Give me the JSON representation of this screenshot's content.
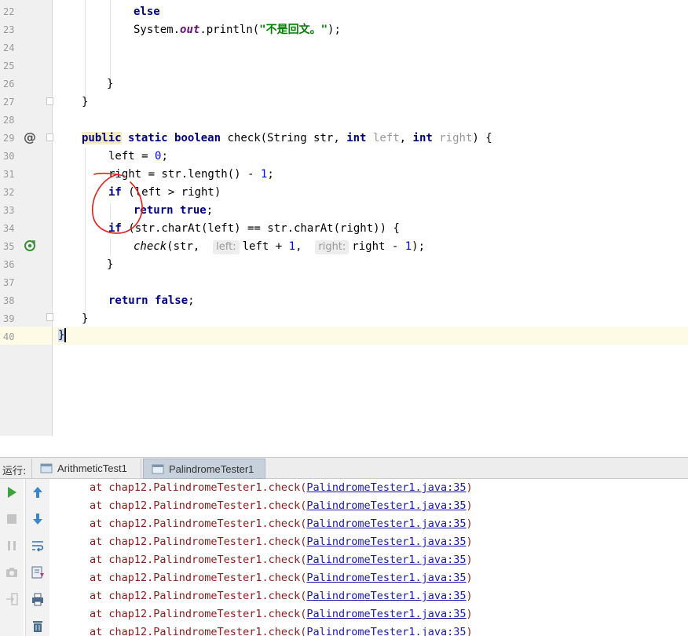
{
  "editor": {
    "line_numbers": [
      "22",
      "23",
      "24",
      "25",
      "26",
      "27",
      "28",
      "29",
      "30",
      "31",
      "32",
      "33",
      "34",
      "35",
      "36",
      "37",
      "38",
      "39",
      "40"
    ],
    "code": {
      "l22_else": "else",
      "l23_system": "System.",
      "l23_out": "out",
      "l23_println": ".println(",
      "l23_string": "\"不是回文。\"",
      "l23_end": ");",
      "l26": "}",
      "l27": "}",
      "l29_public": "public",
      "l29_static": "static",
      "l29_boolean": "boolean",
      "l29_sig1": " check(String str, ",
      "l29_int1": "int",
      "l29_left": "left",
      "l29_comma": ", ",
      "l29_int2": "int",
      "l29_right": "right",
      "l29_end": ") {",
      "l30_a": "left = ",
      "l30_num": "0",
      "l30_end": ";",
      "l31_a": "right = str.length() - ",
      "l31_num": "1",
      "l31_end": ";",
      "l32_if": "if",
      "l32_rest": " (left > right)",
      "l33_return": "return",
      "l33_true": "true",
      "l33_end": ";",
      "l34_if": "if",
      "l34_rest": " (str.charAt(left) == str.charAt(right)) {",
      "l35_check": "check",
      "l35_a": "(str,  ",
      "l35_hint_left": "left:",
      "l35_b": "left + ",
      "l35_num1": "1",
      "l35_c": ",  ",
      "l35_hint_right": "right:",
      "l35_d": "right - ",
      "l35_num2": "1",
      "l35_end": ");",
      "l36": "}",
      "l38_return": "return",
      "l38_false": "false",
      "l38_end": ";",
      "l39": "}",
      "l40": "}"
    },
    "gutter_marks": {
      "override": "@"
    }
  },
  "run_panel": {
    "label": "运行:",
    "tabs": [
      {
        "label": "ArithmeticTest1",
        "active": false
      },
      {
        "label": "PalindromeTester1",
        "active": true
      }
    ],
    "console_lines": [
      {
        "prefix": "at chap12.PalindromeTester1.check(",
        "link": "PalindromeTester1.java:35",
        "suffix": ")"
      },
      {
        "prefix": "at chap12.PalindromeTester1.check(",
        "link": "PalindromeTester1.java:35",
        "suffix": ")"
      },
      {
        "prefix": "at chap12.PalindromeTester1.check(",
        "link": "PalindromeTester1.java:35",
        "suffix": ")"
      },
      {
        "prefix": "at chap12.PalindromeTester1.check(",
        "link": "PalindromeTester1.java:35",
        "suffix": ")"
      },
      {
        "prefix": "at chap12.PalindromeTester1.check(",
        "link": "PalindromeTester1.java:35",
        "suffix": ")"
      },
      {
        "prefix": "at chap12.PalindromeTester1.check(",
        "link": "PalindromeTester1.java:35",
        "suffix": ")"
      },
      {
        "prefix": "at chap12.PalindromeTester1.check(",
        "link": "PalindromeTester1.java:35",
        "suffix": ")"
      },
      {
        "prefix": "at chap12.PalindromeTester1.check(",
        "link": "PalindromeTester1.java:35",
        "suffix": ")"
      },
      {
        "prefix": "at chap12.PalindromeTester1.check(",
        "link": "PalindromeTester1.java:35",
        "suffix": ")"
      }
    ]
  },
  "colors": {
    "keyword": "#000080",
    "string": "#008000",
    "number": "#0000ff",
    "console_error": "#8b1a1a",
    "link": "#1a1aa6",
    "annotation": "#e0201a"
  },
  "icons": [
    "run-icon",
    "stop-icon",
    "pause-icon",
    "camera-icon",
    "exit-icon",
    "up-arrow-icon",
    "down-arrow-icon",
    "wrap-icon",
    "scroll-to-end-icon",
    "print-icon",
    "trash-icon",
    "recursion-icon",
    "fold-icon"
  ]
}
